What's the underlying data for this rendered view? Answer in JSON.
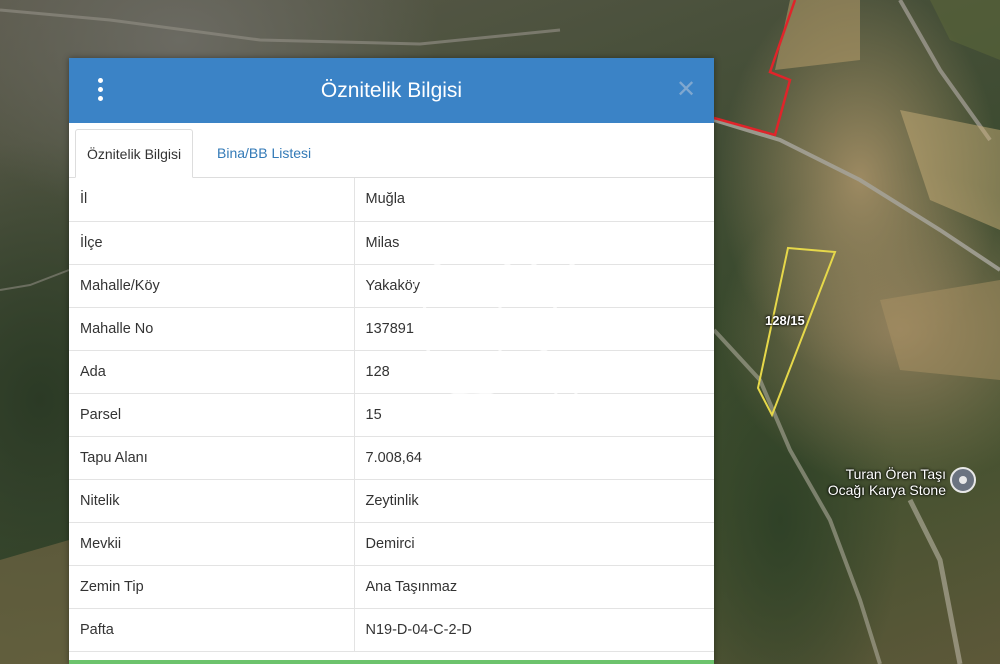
{
  "map": {
    "parcel_label": "128/15",
    "poi": {
      "line1": "Turan Ören Taşı",
      "line2": "Ocağı Karya Stone",
      "icon": "location-pin-icon"
    }
  },
  "panel": {
    "title": "Öznitelik Bilgisi",
    "menu_icon": "vertical-dots-icon",
    "close_icon": "close-icon",
    "tabs": [
      {
        "label": "Öznitelik Bilgisi",
        "active": true
      },
      {
        "label": "Bina/BB Listesi",
        "active": false
      }
    ],
    "rows": [
      {
        "key": "İl",
        "value": "Muğla"
      },
      {
        "key": "İlçe",
        "value": "Milas"
      },
      {
        "key": "Mahalle/Köy",
        "value": "Yakaköy"
      },
      {
        "key": "Mahalle No",
        "value": "137891"
      },
      {
        "key": "Ada",
        "value": "128"
      },
      {
        "key": "Parsel",
        "value": "15"
      },
      {
        "key": "Tapu Alanı",
        "value": "7.008,64"
      },
      {
        "key": "Nitelik",
        "value": "Zeytinlik"
      },
      {
        "key": "Mevkii",
        "value": "Demirci"
      },
      {
        "key": "Zemin Tip",
        "value": "Ana Taşınmaz"
      },
      {
        "key": "Pafta",
        "value": "N19-D-04-C-2-D"
      }
    ]
  },
  "watermark": {
    "mark": "SM"
  },
  "colors": {
    "header": "#3b83c6",
    "tab_link": "#337ab7",
    "parcel_outline": "#e6d84a",
    "neighbor_outline": "#e0242a",
    "bottom_strip": "#6cc36c"
  }
}
